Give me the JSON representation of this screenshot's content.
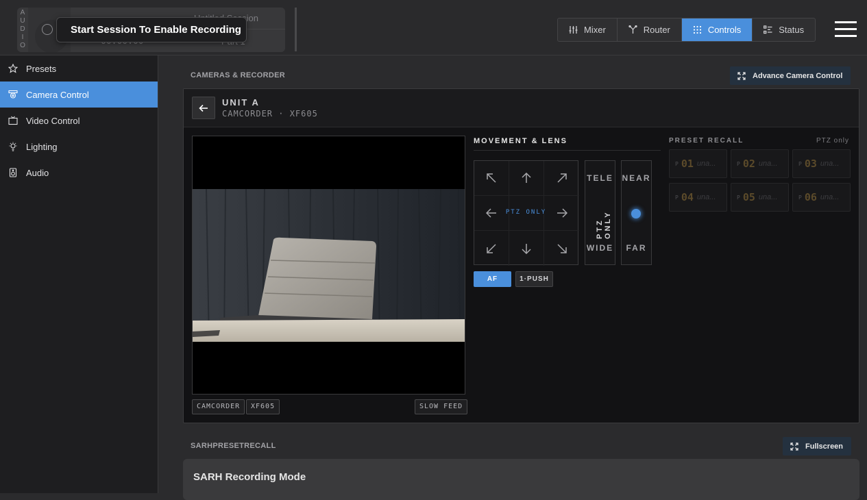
{
  "audio": {
    "vertical_label": [
      "A",
      "U",
      "D",
      "I",
      "O"
    ],
    "session_title": "Untitled Session",
    "timecode": "00:00:00",
    "part": "Part 1",
    "tooltip": "Start Session To Enable Recording"
  },
  "nav": {
    "tabs": [
      {
        "label": "Mixer",
        "icon": "sliders-icon"
      },
      {
        "label": "Router",
        "icon": "router-fork-icon"
      },
      {
        "label": "Controls",
        "icon": "grid-dots-icon",
        "active": true
      },
      {
        "label": "Status",
        "icon": "status-list-icon"
      }
    ]
  },
  "sidebar": {
    "items": [
      {
        "label": "Presets",
        "icon": "star-icon"
      },
      {
        "label": "Camera Control",
        "icon": "camera-icon",
        "active": true
      },
      {
        "label": "Video Control",
        "icon": "tv-icon"
      },
      {
        "label": "Lighting",
        "icon": "bulb-icon"
      },
      {
        "label": "Audio",
        "icon": "speaker-icon"
      }
    ]
  },
  "cameras": {
    "section_title": "CAMERAS & RECORDER",
    "advance_button": "Advance Camera Control",
    "unit_name": "UNIT A",
    "unit_sub": "CAMCORDER · XF605",
    "tags": [
      "CAMCORDER",
      "XF605"
    ],
    "feed_tag": "SLOW FEED",
    "movement_title": "MOVEMENT & LENS",
    "ptz_only_label": "PTZ ONLY",
    "zoom": {
      "top": "TELE",
      "middle": "PTZ ONLY",
      "bottom": "WIDE"
    },
    "focus": {
      "top": "NEAR",
      "bottom": "FAR",
      "level": 0.5
    },
    "af_button": "AF",
    "one_push_button": "1·PUSH",
    "preset_title": "PRESET RECALL",
    "preset_note": "PTZ only",
    "presets": [
      {
        "p": "P",
        "num": "01",
        "status": "una..."
      },
      {
        "p": "P",
        "num": "02",
        "status": "una..."
      },
      {
        "p": "P",
        "num": "03",
        "status": "una..."
      },
      {
        "p": "P",
        "num": "04",
        "status": "una..."
      },
      {
        "p": "P",
        "num": "05",
        "status": "una..."
      },
      {
        "p": "P",
        "num": "06",
        "status": "una..."
      }
    ]
  },
  "sarh": {
    "section_title": "SARHPRESETRECALL",
    "fullscreen_button": "Fullscreen",
    "panel_title": "SARH Recording Mode"
  }
}
